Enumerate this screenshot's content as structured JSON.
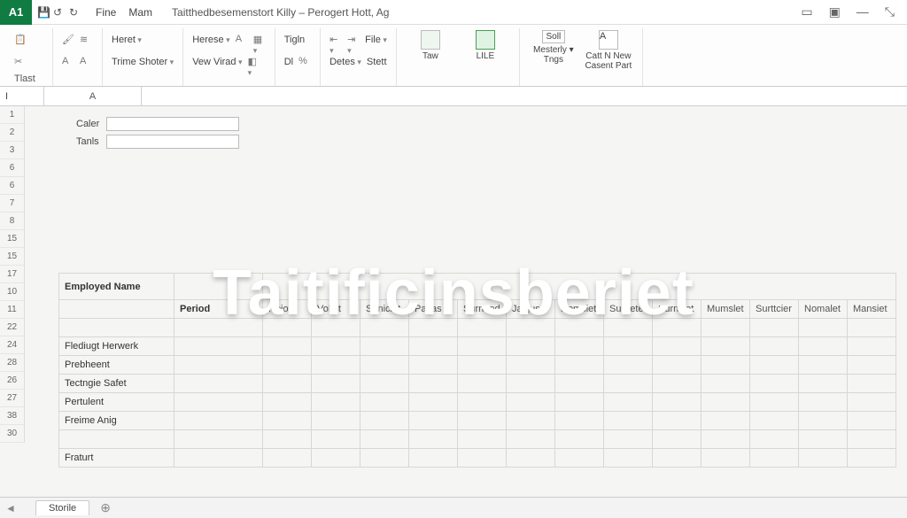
{
  "titlebar": {
    "app_badge": "A1",
    "menu": {
      "file": "Fine",
      "main": "Mam"
    },
    "doc_title": "Taitthedbesemenstort Killy – Perogert Hott, Ag",
    "win_icons": {
      "ribbon_opts": "▭",
      "help": "▣",
      "min": "—",
      "restore": "⤡"
    }
  },
  "ribbon": {
    "group_paste": {
      "label": "Tlast"
    },
    "group_font": {
      "name": "Heret",
      "style_row": "Trime Shoter"
    },
    "group_align": {
      "name": "Herese",
      "view": "Vew Virad"
    },
    "group_num": {
      "name": "Tigln",
      "dl": "Dl"
    },
    "group_file": {
      "name": "File",
      "detes": "Detes",
      "stett": "Stett"
    },
    "big1": {
      "label": "Taw"
    },
    "big2": {
      "label": "LILE"
    },
    "big3": {
      "label1": "Mesterly",
      "label2": "Tngs"
    },
    "big4": {
      "label1": "Catt N New",
      "label2": "Casent Part"
    },
    "sort": "Soll"
  },
  "namebox": "I",
  "col_a_header": "A",
  "filters": {
    "row1_label": "Caler",
    "row2_label": "Tanls"
  },
  "watermark": "Taitificinsberiet",
  "row_numbers": [
    "1",
    "2",
    "3",
    "6",
    "6",
    "7",
    "8",
    "15",
    "15",
    "17",
    "10",
    "11",
    "22",
    "24",
    "28",
    "26",
    "27",
    "38",
    "30"
  ],
  "table": {
    "header_main": "Employed Name",
    "header_period": "Period",
    "columns": [
      "Nojot",
      "Vollot",
      "Suniciet",
      "Payas",
      "Surneed",
      "Jalguss",
      "Nomciet",
      "Surnetef",
      "Surnciet",
      "Mumslet",
      "Surttcier",
      "Nomalet",
      "Mansiet"
    ],
    "rows": [
      "Flediugt Herwerk",
      "Prebheent",
      "Tectngie Safet",
      "Pertulent",
      "Freime Anig",
      "",
      "Fraturt"
    ]
  },
  "tabbar": {
    "sheet1": "Storile",
    "add": "⊕"
  }
}
